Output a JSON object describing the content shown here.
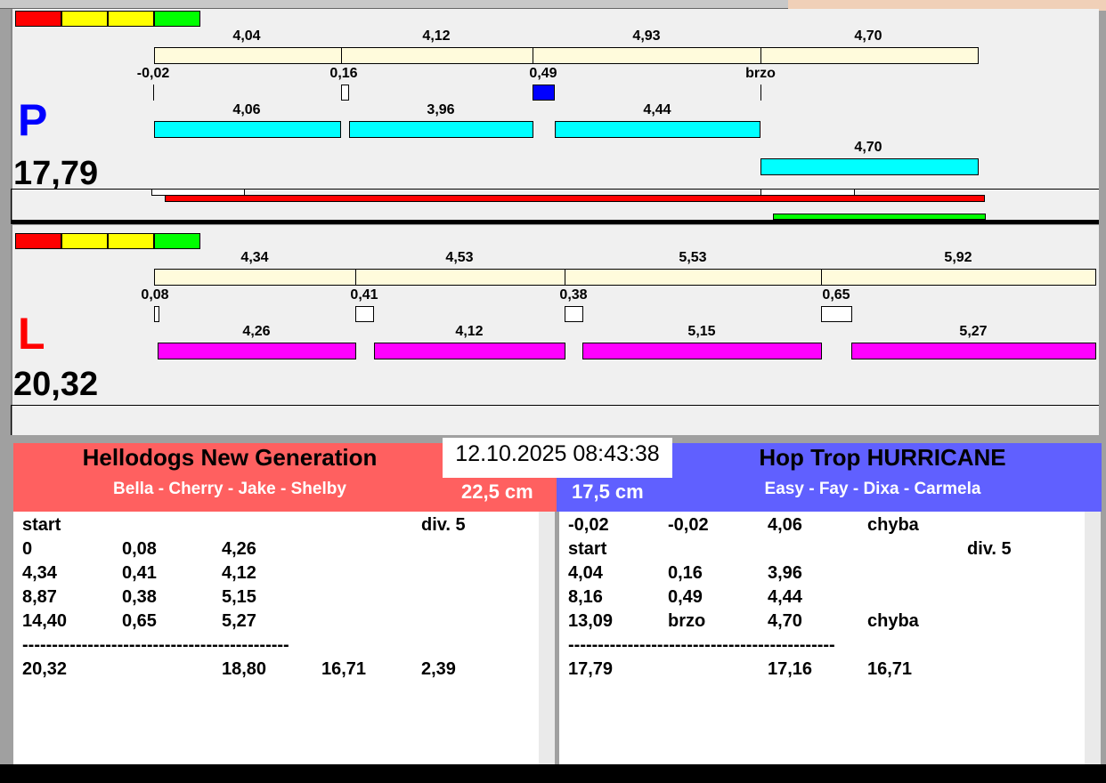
{
  "colors": {
    "red_team": "#ff6060",
    "blue_team": "#6060ff",
    "cyan": "#00ffff",
    "magenta": "#ff00ff",
    "fault_blue": "#0000ff"
  },
  "top_lane": {
    "letter": "P",
    "total": "17,79",
    "run_times": [
      "4,04",
      "4,12",
      "4,93",
      "4,70"
    ],
    "reactions": [
      "-0,02",
      "0,16",
      "0,49",
      "brzo"
    ],
    "dog_times": [
      "4,06",
      "3,96",
      "4,44",
      "4,70"
    ]
  },
  "bottom_lane": {
    "letter": "L",
    "total": "20,32",
    "run_times": [
      "4,34",
      "4,53",
      "5,53",
      "5,92"
    ],
    "reactions": [
      "0,08",
      "0,41",
      "0,38",
      "0,65"
    ],
    "dog_times": [
      "4,26",
      "4,12",
      "5,15",
      "5,27"
    ]
  },
  "datetime": "12.10.2025 08:43:38",
  "left_team": {
    "name": "Hellodogs New Generation",
    "dogs": "Bella - Cherry - Jake - Shelby",
    "height": "22,5 cm",
    "rows": [
      [
        "start",
        "",
        "",
        "",
        "div.  5"
      ],
      [
        "0",
        "0,08",
        "4,26",
        "",
        ""
      ],
      [
        "4,34",
        "0,41",
        "4,12",
        "",
        ""
      ],
      [
        "8,87",
        "0,38",
        "5,15",
        "",
        ""
      ],
      [
        "14,40",
        "0,65",
        "5,27",
        "",
        ""
      ],
      [
        "---------------------------------------------",
        "",
        "",
        "",
        ""
      ],
      [
        "20,32",
        "",
        "18,80",
        "16,71",
        "2,39"
      ]
    ]
  },
  "right_team": {
    "name": "Hop Trop HURRICANE",
    "dogs": "Easy - Fay - Dixa - Carmela",
    "height": "17,5 cm",
    "rows": [
      [
        "-0,02",
        "-0,02",
        "4,06",
        "chyba",
        ""
      ],
      [
        "start",
        "",
        "",
        "",
        "div.  5"
      ],
      [
        "4,04",
        "0,16",
        "3,96",
        "",
        ""
      ],
      [
        "8,16",
        "0,49",
        "4,44",
        "",
        ""
      ],
      [
        "13,09",
        "brzo",
        "4,70",
        "chyba",
        ""
      ],
      [
        "---------------------------------------------",
        "",
        "",
        "",
        ""
      ],
      [
        "17,79",
        "",
        "17,16",
        "16,71",
        ""
      ]
    ]
  }
}
